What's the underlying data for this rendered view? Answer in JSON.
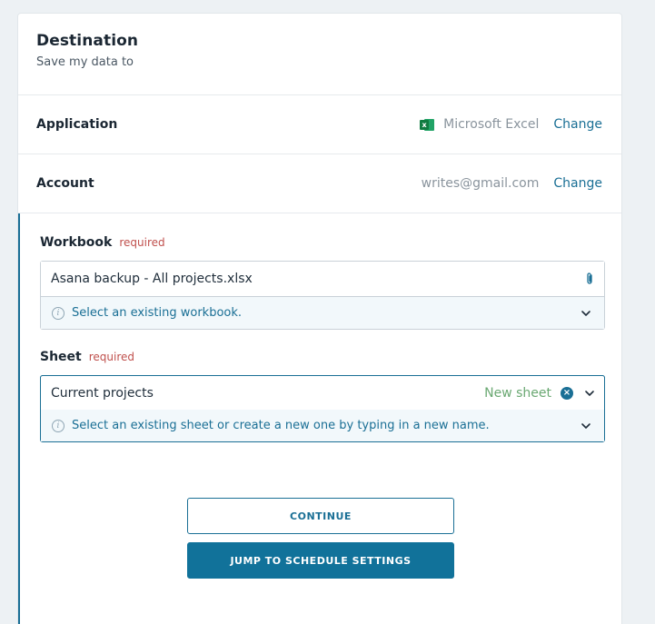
{
  "destination": {
    "title": "Destination",
    "subtitle": "Save my data to"
  },
  "application": {
    "label": "Application",
    "value": "Microsoft Excel",
    "icon": "excel-icon",
    "change_label": "Change"
  },
  "account": {
    "label": "Account",
    "value": "writes@gmail.com",
    "change_label": "Change"
  },
  "workbook": {
    "label": "Workbook",
    "required_label": "required",
    "value": "Asana backup - All projects.xlsx",
    "hint": "Select an existing workbook."
  },
  "sheet": {
    "label": "Sheet",
    "required_label": "required",
    "value": "Current projects",
    "badge": "New sheet",
    "hint": "Select an existing sheet or create a new one by typing in a new name."
  },
  "buttons": {
    "continue_label": "CONTINUE",
    "jump_label": "JUMP TO SCHEDULE SETTINGS"
  },
  "colors": {
    "accent": "#1a6f95",
    "required": "#c0504d",
    "new_sheet": "#6aa872",
    "excel_green": "#107c41"
  }
}
